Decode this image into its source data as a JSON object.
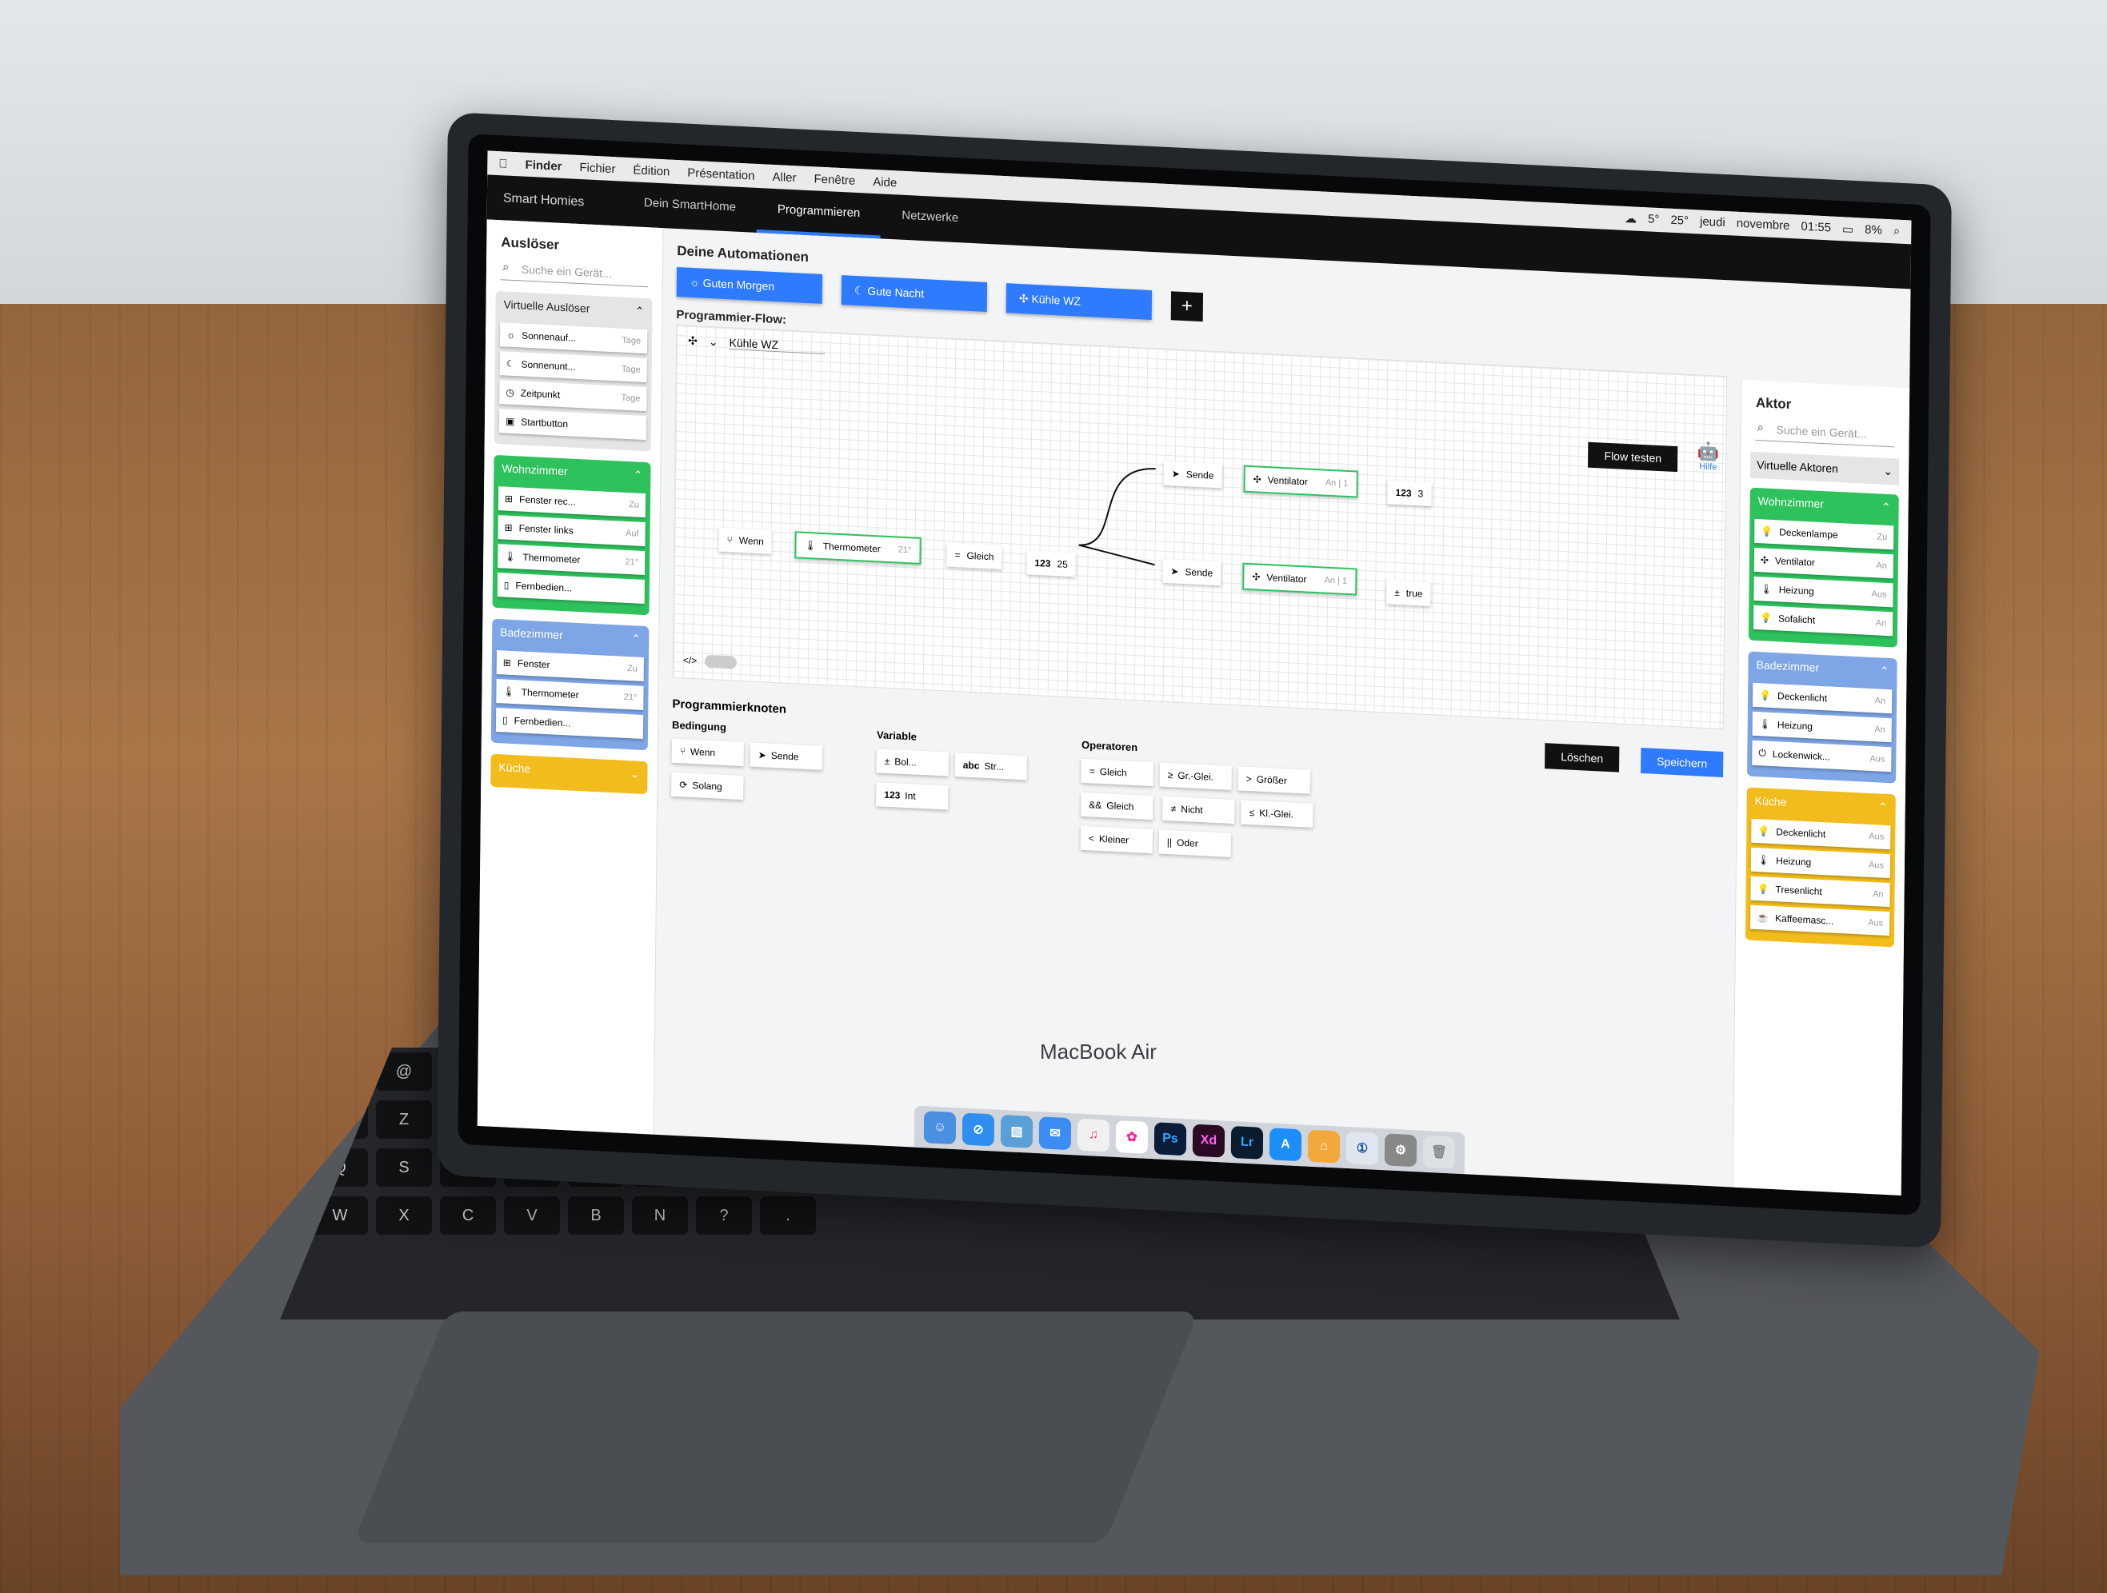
{
  "macmenu": {
    "items": [
      "Finder",
      "Fichier",
      "Édition",
      "Présentation",
      "Aller",
      "Fenêtre",
      "Aide"
    ],
    "status": [
      "5°",
      "25°",
      "jeudi",
      "novembre",
      "01:55",
      "8%"
    ]
  },
  "app": {
    "logo": "Smart Homies",
    "tabs": [
      "Dein SmartHome",
      "Programmieren",
      "Netzwerke"
    ]
  },
  "left": {
    "title": "Auslöser",
    "search_placeholder": "Suche ein Gerät...",
    "groups": [
      {
        "name": "Virtuelle Auslöser",
        "items": [
          {
            "label": "Sonnenauf...",
            "state": "Tage"
          },
          {
            "label": "Sonnenunt...",
            "state": "Tage"
          },
          {
            "label": "Zeitpunkt",
            "state": "Tage"
          },
          {
            "label": "Startbutton",
            "state": ""
          }
        ]
      },
      {
        "name": "Wohnzimmer",
        "items": [
          {
            "label": "Fenster rec...",
            "state": "Zu"
          },
          {
            "label": "Fenster links",
            "state": "Auf"
          },
          {
            "label": "Thermometer",
            "state": "21°"
          },
          {
            "label": "Fernbedien...",
            "state": ""
          }
        ]
      },
      {
        "name": "Badezimmer",
        "items": [
          {
            "label": "Fenster",
            "state": "Zu"
          },
          {
            "label": "Thermometer",
            "state": "21°"
          },
          {
            "label": "Fernbedien...",
            "state": ""
          }
        ]
      },
      {
        "name": "Küche",
        "items": []
      }
    ]
  },
  "center": {
    "automations_title": "Deine Automationen",
    "automations": [
      "Guten Morgen",
      "Gute Nacht",
      "Kühle WZ"
    ],
    "add": "+",
    "flow_title": "Programmier-Flow:",
    "flow_name": "Kühle WZ",
    "flow_test": "Flow testen",
    "help": "Hilfe",
    "nodes": {
      "wenn": "Wenn",
      "thermometer": "Thermometer",
      "thermo_state": "21°",
      "gleich": "Gleich",
      "int_tag": "123",
      "int_val": "25",
      "sende1": "Sende",
      "vent1": "Ventilator",
      "vent1_state": "An | 1",
      "val1_tag": "123",
      "val1": "3",
      "sende2": "Sende",
      "vent2": "Ventilator",
      "vent2_state": "An | 1",
      "val2": "true"
    },
    "code_toggle": "</>",
    "nodes_title": "Programmierknoten",
    "bedingung": "Bedingung",
    "bed_items": [
      "Wenn",
      "Sende",
      "Solang"
    ],
    "variable": "Variable",
    "var_items": [
      "Bol...",
      "Str...",
      "Int"
    ],
    "operatoren": "Operatoren",
    "op_items": [
      "Gleich",
      "Gr.-Glei.",
      "Größer",
      "Gleich",
      "Nicht",
      "Kl.-Glei.",
      "Kleiner",
      "Oder"
    ],
    "delete": "Löschen",
    "save": "Speichern"
  },
  "right": {
    "title": "Aktor",
    "search_placeholder": "Suche ein Gerät...",
    "dropdown": "Virtuelle Aktoren",
    "groups": [
      {
        "name": "Wohnzimmer",
        "items": [
          {
            "label": "Deckenlampe",
            "state": "Zu"
          },
          {
            "label": "Ventilator",
            "state": "An"
          },
          {
            "label": "Heizung",
            "state": "Aus"
          },
          {
            "label": "Sofalicht",
            "state": "An"
          }
        ]
      },
      {
        "name": "Badezimmer",
        "items": [
          {
            "label": "Deckenlicht",
            "state": "An"
          },
          {
            "label": "Heizung",
            "state": "An"
          },
          {
            "label": "Lockenwick...",
            "state": "Aus"
          }
        ]
      },
      {
        "name": "Küche",
        "items": [
          {
            "label": "Deckenlicht",
            "state": "Aus"
          },
          {
            "label": "Heizung",
            "state": "Aus"
          },
          {
            "label": "Tresenlicht",
            "state": "An"
          },
          {
            "label": "Kaffeemasc...",
            "state": "Aus"
          }
        ]
      }
    ]
  },
  "dock": [
    "Ps",
    "Xd",
    "Lr"
  ],
  "laptop_brand": "MacBook Air",
  "colors": {
    "green": "#2ec25d",
    "blue": "#2f7bff",
    "yellow": "#f2bd1c",
    "light_blue": "#7ea5e6"
  }
}
